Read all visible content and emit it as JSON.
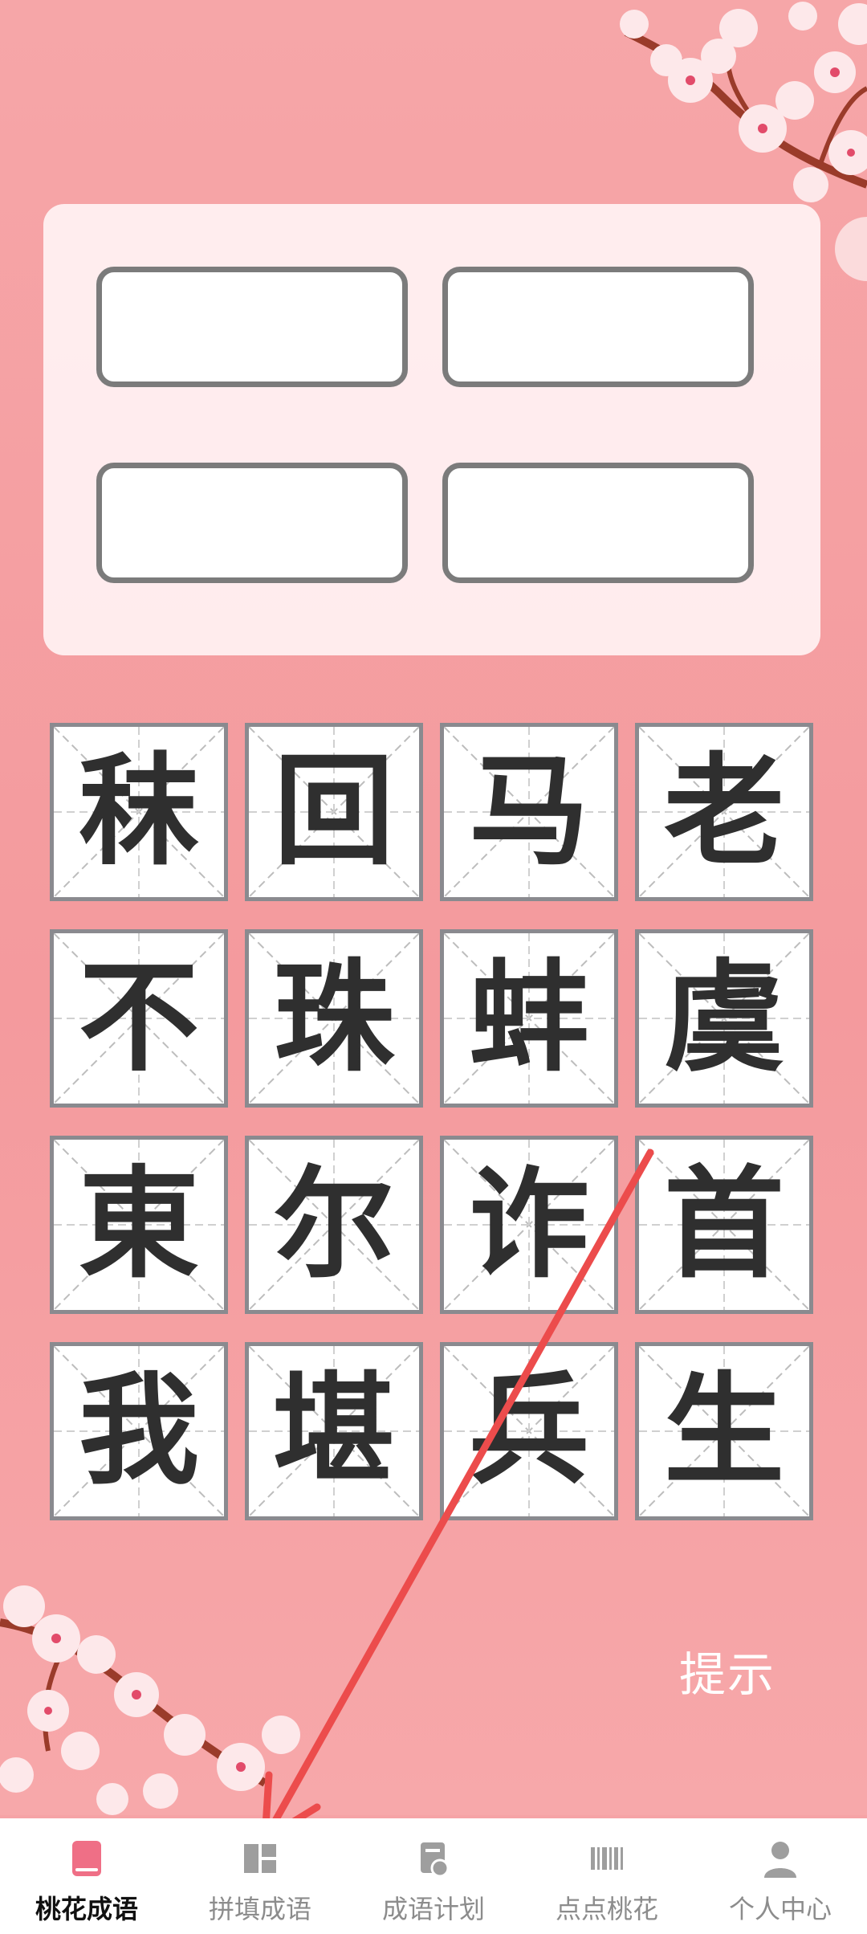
{
  "tiles": [
    "秣",
    "回",
    "马",
    "老",
    "不",
    "珠",
    "蚌",
    "虞",
    "東",
    "尔",
    "诈",
    "首",
    "我",
    "堪",
    "兵",
    "生"
  ],
  "hint_label": "提示",
  "tabs": [
    {
      "label": "桃花成语",
      "icon": "book-icon",
      "active": true
    },
    {
      "label": "拼填成语",
      "icon": "blocks-icon",
      "active": false
    },
    {
      "label": "成语计划",
      "icon": "plan-icon",
      "active": false
    },
    {
      "label": "点点桃花",
      "icon": "barcode-icon",
      "active": false
    },
    {
      "label": "个人中心",
      "icon": "person-icon",
      "active": false
    }
  ],
  "colors": {
    "background": "#f6a3a6",
    "accent": "#ef6f86",
    "slot_border": "#7b7b7b",
    "arrow": "#ec4c4c"
  }
}
